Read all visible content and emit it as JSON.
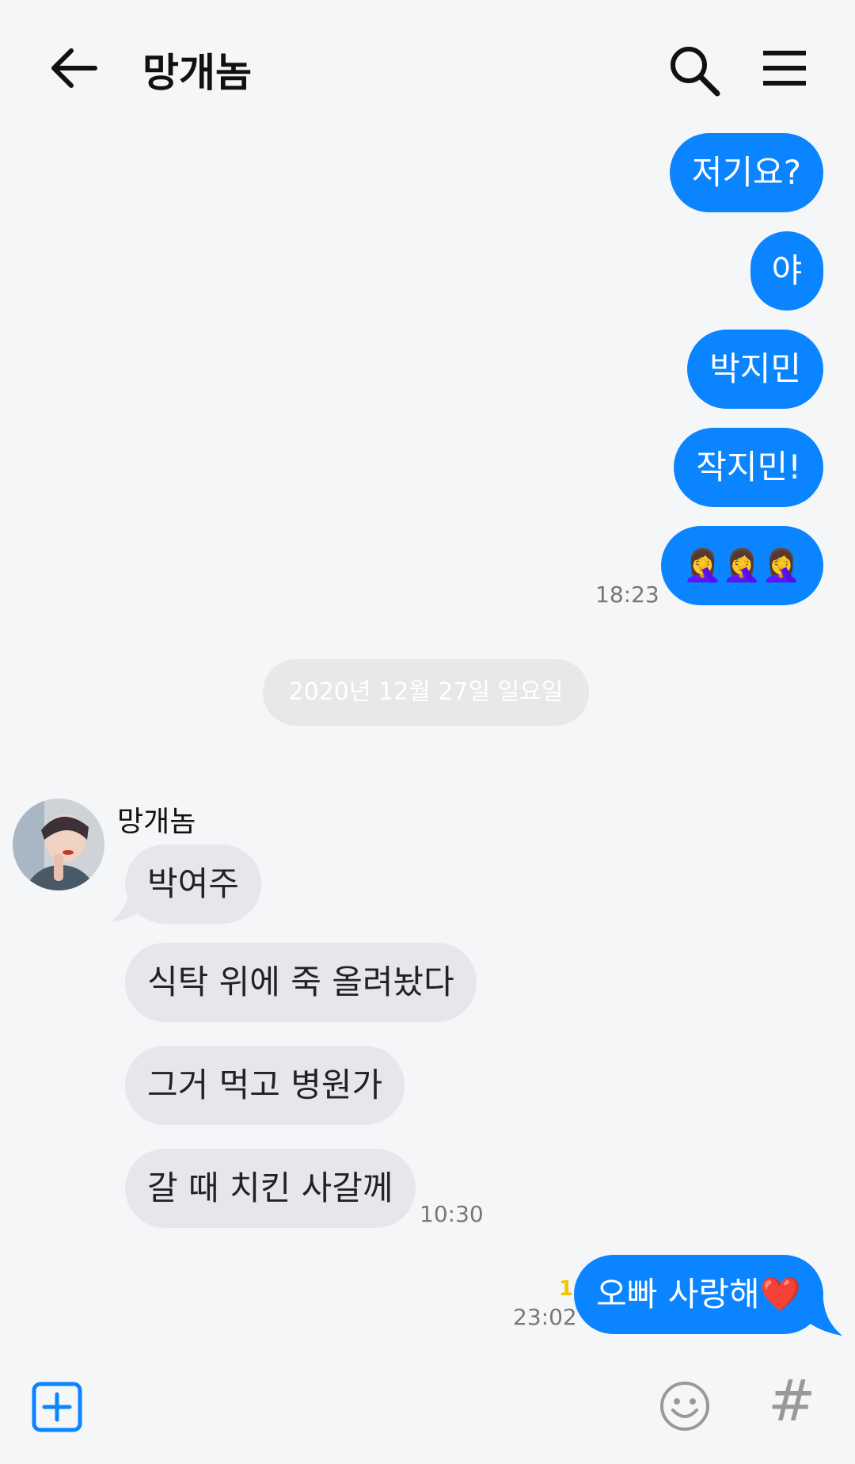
{
  "header": {
    "title": "망개놈",
    "back_icon": "arrow-left-icon",
    "search_icon": "search-icon",
    "menu_icon": "hamburger-menu-icon"
  },
  "messages_sent_1": [
    "저기요?",
    "야",
    "박지민",
    "작지민!",
    "🤦‍♀️🤦‍♀️🤦‍♀️"
  ],
  "time_1": "18:23",
  "date_separator": "2020년 12월 27일 일요일",
  "sender_name": "망개놈",
  "messages_received": [
    "박여주",
    "식탁 위에 죽 올려놨다",
    "그거 먹고 병원가",
    "갈 때 치킨 사갈께"
  ],
  "time_2": "10:30",
  "last_message": {
    "text": "오빠 사랑해❤️",
    "unread_count": "1",
    "time": "23:02"
  },
  "input_bar": {
    "plus_icon": "plus-icon",
    "emoji_icon": "smiley-icon",
    "hash_icon": "hashtag-icon",
    "hash_glyph": "#"
  },
  "colors": {
    "my_bubble": "#0a84ff",
    "their_bubble": "#e6e6eb",
    "background": "#f5f6f8"
  }
}
